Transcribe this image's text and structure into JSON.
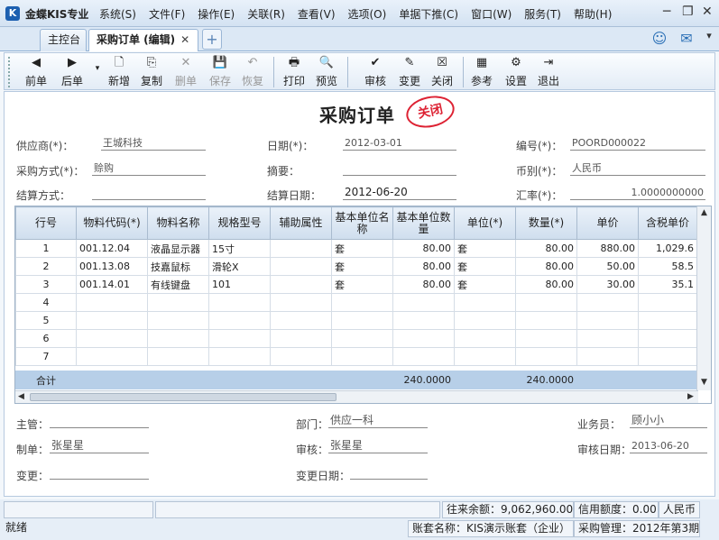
{
  "app": {
    "logo": "K",
    "name": "金蝶KIS专业"
  },
  "menu": [
    "系统(S)",
    "文件(F)",
    "操作(E)",
    "关联(R)",
    "查看(V)",
    "选项(O)",
    "单据下推(C)",
    "窗口(W)",
    "服务(T)",
    "帮助(H)"
  ],
  "window_controls": {
    "min": "─",
    "restore": "❐",
    "close": "✕"
  },
  "tabs": [
    {
      "label": "主控台"
    },
    {
      "label": "采购订单 (编辑)",
      "close": "✕"
    }
  ],
  "tab_new": "+",
  "toolbar": [
    {
      "label": "前单",
      "icon": "◀"
    },
    {
      "label": "后单",
      "icon": "▶"
    },
    {
      "label": "新增",
      "icon": "🗋"
    },
    {
      "label": "复制",
      "icon": "⎘"
    },
    {
      "label": "删单",
      "icon": "✕"
    },
    {
      "label": "保存",
      "icon": "💾"
    },
    {
      "label": "恢复",
      "icon": "↶"
    },
    {
      "label": "打印",
      "icon": "🖶"
    },
    {
      "label": "预览",
      "icon": "🔍"
    },
    {
      "label": "审核",
      "icon": "✔"
    },
    {
      "label": "变更",
      "icon": "✎"
    },
    {
      "label": "关闭",
      "icon": "☒"
    },
    {
      "label": "参考",
      "icon": "▦"
    },
    {
      "label": "设置",
      "icon": "⚙"
    },
    {
      "label": "退出",
      "icon": "⇥"
    }
  ],
  "doc": {
    "title": "采购订单",
    "stamp": "关闭"
  },
  "header": {
    "supplier_label": "供应商(*)：",
    "supplier": "王城科技",
    "date_label": "日期(*)：",
    "date": "2012-03-01",
    "number_label": "编号(*)：",
    "number": "POORD000022",
    "method_label": "采购方式(*)：",
    "method": "赊购",
    "summary_label": "摘要：",
    "summary": "",
    "currency_label": "币别(*)：",
    "currency": "人民币",
    "settle_label": "结算方式：",
    "settle": "",
    "settle_date_label": "结算日期：",
    "settle_date": "2012-06-20",
    "rate_label": "汇率(*)：",
    "rate": "1.0000000000"
  },
  "grid": {
    "columns": [
      "行号",
      "物料代码(*)",
      "物料名称",
      "规格型号",
      "辅助属性",
      "基本单位名称",
      "基本单位数量",
      "单位(*)",
      "数量(*)",
      "单价",
      "含税单价"
    ],
    "rows": [
      [
        "1",
        "001.12.04",
        "液晶显示器",
        "15寸",
        "",
        "套",
        "80.00",
        "套",
        "80.00",
        "880.00",
        "1,029.6"
      ],
      [
        "2",
        "001.13.08",
        "技嘉鼠标",
        "滑轮X",
        "",
        "套",
        "80.00",
        "套",
        "80.00",
        "50.00",
        "58.5"
      ],
      [
        "3",
        "001.14.01",
        "有线键盘",
        "101",
        "",
        "套",
        "80.00",
        "套",
        "80.00",
        "30.00",
        "35.1"
      ],
      [
        "4",
        "",
        "",
        "",
        "",
        "",
        "",
        "",
        "",
        "",
        ""
      ],
      [
        "5",
        "",
        "",
        "",
        "",
        "",
        "",
        "",
        "",
        "",
        ""
      ],
      [
        "6",
        "",
        "",
        "",
        "",
        "",
        "",
        "",
        "",
        "",
        ""
      ],
      [
        "7",
        "",
        "",
        "",
        "",
        "",
        "",
        "",
        "",
        "",
        ""
      ]
    ],
    "total_label": "合计",
    "total_base_qty": "240.0000",
    "total_qty": "240.0000"
  },
  "footer": {
    "manager_label": "主管：",
    "manager": "",
    "dept_label": "部门：",
    "dept": "供应一科",
    "clerk_label": "业务员：",
    "clerk": "顾小小",
    "maker_label": "制单：",
    "maker": "张星星",
    "reviewer_label": "审核：",
    "reviewer": "张星星",
    "review_date_label": "审核日期：",
    "review_date": "2013-06-20",
    "change_label": "变更：",
    "change": "",
    "change_date_label": "变更日期：",
    "change_date": ""
  },
  "status": {
    "balance": "往来余额：9,062,960.00",
    "credit": "信用额度：0.00",
    "currency": "人民币",
    "ready": "就绪",
    "account": "账套名称：KIS演示账套（企业）",
    "period": "采购管理：2012年第3期"
  }
}
